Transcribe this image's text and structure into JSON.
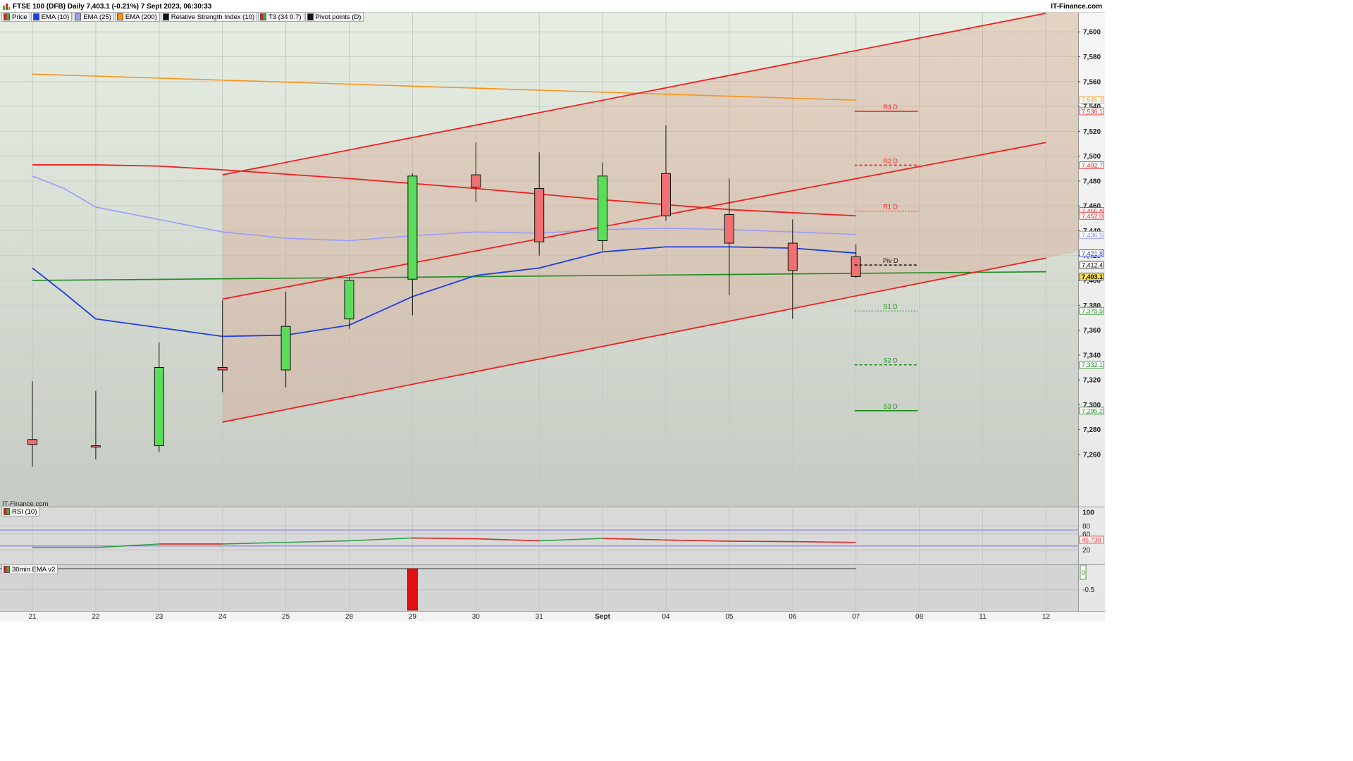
{
  "title_bar": {
    "title": "FTSE 100 (DFB) Daily 7,403.1 (-0.21%) 7 Sept 2023, 06:30:33",
    "brand": "IT-Finance.com"
  },
  "legend": [
    {
      "label": "Price",
      "color": "#3cb043"
    },
    {
      "label": "EMA (10)",
      "color": "#1f3fe0"
    },
    {
      "label": "EMA (25)",
      "color": "#9c9cf8"
    },
    {
      "label": "EMA (200)",
      "color": "#f7941d"
    },
    {
      "label": "Relative Strength Index (10)",
      "color": "#111111"
    },
    {
      "label": "T3 (34 0.7)",
      "color": "#e41a1c"
    },
    {
      "label": "Pivot points (D)",
      "color": "#111111"
    }
  ],
  "watermark": "IT-Finance.com",
  "colors": {
    "bull": "#5bdc5b",
    "bear": "#ef7070",
    "ema10": "#1f3fe0",
    "ema25": "#9c9cf8",
    "ema200": "#f7941d",
    "channel": "#ee2222",
    "t3": "#ee2222",
    "green_line": "#1f8a1f",
    "rsi_up": "#2a9d4a",
    "rsi_down": "#ee2222"
  },
  "chart_data": [
    {
      "type": "candlestick",
      "name": "price",
      "x_labels": [
        "21",
        "22",
        "23",
        "24",
        "25",
        "28",
        "29",
        "30",
        "31",
        "Sept",
        "04",
        "05",
        "06",
        "07",
        "08",
        "11",
        "12"
      ],
      "y_ticks": [
        7260,
        7280,
        7300,
        7320,
        7340,
        7360,
        7380,
        7400,
        7420,
        7440,
        7460,
        7480,
        7500,
        7520,
        7540,
        7560,
        7580,
        7600
      ],
      "y_tick_labels": [
        "7,260",
        "7,280",
        "7,300",
        "7,320",
        "7,340",
        "7,360",
        "7,380",
        "7,400",
        "7,420",
        "7,440",
        "7,460",
        "7,480",
        "7,500",
        "7,520",
        "7,540",
        "7,560",
        "7,580",
        "7,600"
      ],
      "ylim": [
        7218,
        7616
      ],
      "candles": [
        {
          "x": 0,
          "open": 7272,
          "high": 7319,
          "low": 7250,
          "close": 7268
        },
        {
          "x": 1,
          "open": 7267,
          "high": 7311,
          "low": 7256,
          "close": 7266
        },
        {
          "x": 2,
          "open": 7267,
          "high": 7350,
          "low": 7262,
          "close": 7330
        },
        {
          "x": 3,
          "open": 7330,
          "high": 7384,
          "low": 7310,
          "close": 7328
        },
        {
          "x": 4,
          "open": 7328,
          "high": 7391,
          "low": 7314,
          "close": 7363
        },
        {
          "x": 5,
          "open": 7369,
          "high": 7402,
          "low": 7361,
          "close": 7400
        },
        {
          "x": 6,
          "open": 7401,
          "high": 7486,
          "low": 7372,
          "close": 7484
        },
        {
          "x": 7,
          "open": 7485,
          "high": 7511,
          "low": 7463,
          "close": 7475
        },
        {
          "x": 8,
          "open": 7474,
          "high": 7503,
          "low": 7420,
          "close": 7431
        },
        {
          "x": 9,
          "open": 7432,
          "high": 7495,
          "low": 7424,
          "close": 7484
        },
        {
          "x": 10,
          "open": 7486,
          "high": 7525,
          "low": 7448,
          "close": 7452
        },
        {
          "x": 11,
          "open": 7453,
          "high": 7482,
          "low": 7388,
          "close": 7430
        },
        {
          "x": 12,
          "open": 7430,
          "high": 7449,
          "low": 7369,
          "close": 7408
        },
        {
          "x": 13,
          "open": 7419,
          "high": 7429,
          "low": 7402,
          "close": 7403.1
        }
      ],
      "ema10": [
        [
          0,
          7410
        ],
        [
          0.5,
          7390
        ],
        [
          1,
          7369
        ],
        [
          3,
          7355
        ],
        [
          4,
          7356
        ],
        [
          5,
          7364
        ],
        [
          6,
          7387
        ],
        [
          7,
          7404
        ],
        [
          8,
          7410
        ],
        [
          9,
          7423
        ],
        [
          10,
          7427
        ],
        [
          11,
          7427
        ],
        [
          12,
          7426
        ],
        [
          13,
          7422
        ]
      ],
      "ema25": [
        [
          0,
          7484
        ],
        [
          0.5,
          7474
        ],
        [
          1,
          7459
        ],
        [
          3,
          7439
        ],
        [
          4,
          7434
        ],
        [
          5,
          7432
        ],
        [
          6,
          7436
        ],
        [
          7,
          7439
        ],
        [
          8,
          7438
        ],
        [
          9,
          7441
        ],
        [
          10,
          7442
        ],
        [
          11,
          7441
        ],
        [
          12,
          7439
        ],
        [
          13,
          7437
        ]
      ],
      "ema200": [
        [
          0,
          7566
        ],
        [
          13,
          7545
        ]
      ],
      "t3": [
        [
          0,
          7493
        ],
        [
          1,
          7493
        ],
        [
          2,
          7492
        ],
        [
          3,
          7489
        ],
        [
          5,
          7482
        ],
        [
          7,
          7474
        ],
        [
          9,
          7465
        ],
        [
          11,
          7457
        ],
        [
          13,
          7452
        ]
      ],
      "green_line": [
        [
          0,
          7400
        ],
        [
          16,
          7407
        ]
      ],
      "channel": {
        "upper": [
          [
            3,
            7485
          ],
          [
            16,
            7615
          ]
        ],
        "middle": [
          [
            3,
            7385
          ],
          [
            16,
            7511
          ]
        ],
        "lower": [
          [
            3,
            7286
          ],
          [
            16,
            7418
          ]
        ],
        "fill_from_x": 3
      },
      "pivots": [
        {
          "label": "R3 D",
          "value": 7536.1,
          "style": "solid",
          "color": "#ee2222"
        },
        {
          "label": "R2 D",
          "value": 7492.7,
          "style": "dashed",
          "color": "#ee2222"
        },
        {
          "label": "R1 D",
          "value": 7455.8,
          "style": "dotted",
          "color": "#ee2222"
        },
        {
          "label": "Piv D",
          "value": 7412.4,
          "style": "dashed",
          "color": "#111111"
        },
        {
          "label": "S1 D",
          "value": 7375.5,
          "style": "dotted",
          "color": "#1f8a1f"
        },
        {
          "label": "S2 D",
          "value": 7332.1,
          "style": "dashed",
          "color": "#1f8a1f"
        },
        {
          "label": "S3 D",
          "value": 7295.2,
          "style": "solid",
          "color": "#1f8a1f"
        }
      ],
      "price_tags": [
        {
          "text": "7,545.3",
          "value": 7545.3,
          "color": "#f7941d",
          "text_color": "#f7941d"
        },
        {
          "text": "7,536.1",
          "value": 7536.1,
          "color": "#ee2222",
          "text_color": "#ee2222"
        },
        {
          "text": "7,492.7",
          "value": 7492.7,
          "color": "#ee2222",
          "text_color": "#ee2222"
        },
        {
          "text": "7,455.8",
          "value": 7455.8,
          "color": "#ee2222",
          "text_color": "#ee2222"
        },
        {
          "text": "7,452.0",
          "value": 7452.0,
          "color": "#ee2222",
          "text_color": "#ee2222"
        },
        {
          "text": "7,436.5",
          "value": 7436.5,
          "color": "#9c9cf8",
          "text_color": "#8080e8"
        },
        {
          "text": "7,421.8",
          "value": 7421.8,
          "color": "#1f3fe0",
          "text_color": "#1f3fe0"
        },
        {
          "text": "7,412.4",
          "value": 7412.4,
          "color": "#333333",
          "text_color": "#000000"
        },
        {
          "text": "7,403.1",
          "value": 7403.1,
          "color": "#333333",
          "text_color": "#000000",
          "bg": "#ffe44d",
          "bold": true
        },
        {
          "text": "7,375.5",
          "value": 7375.5,
          "color": "#1f8a1f",
          "text_color": "#1f8a1f"
        },
        {
          "text": "7,332.1",
          "value": 7332.1,
          "color": "#1f8a1f",
          "text_color": "#1f8a1f"
        },
        {
          "text": "7,295.2",
          "value": 7295.2,
          "color": "#1f8a1f",
          "text_color": "#1f8a1f"
        }
      ]
    },
    {
      "type": "line",
      "name": "rsi",
      "label": "RSI (10)",
      "ylim": [
        0,
        100
      ],
      "y_ticks": [
        100,
        80,
        60,
        20
      ],
      "y_tick_labels": [
        "100",
        "80",
        "60",
        "20"
      ],
      "levels": [
        70,
        30
      ],
      "current_tag": "45.730",
      "current_value": 45.73,
      "values": [
        [
          0,
          26
        ],
        [
          1,
          26
        ],
        [
          2,
          35
        ],
        [
          3,
          35
        ],
        [
          4,
          39
        ],
        [
          5,
          43
        ],
        [
          6,
          50
        ],
        [
          7,
          48
        ],
        [
          8,
          43
        ],
        [
          9,
          49
        ],
        [
          10,
          45
        ],
        [
          11,
          42
        ],
        [
          12,
          41
        ],
        [
          13,
          39
        ]
      ],
      "down_segments": [
        [
          2,
          3
        ],
        [
          6,
          8
        ],
        [
          9,
          13
        ]
      ]
    },
    {
      "type": "bar",
      "name": "ema_30min",
      "label": "30min EMA v2",
      "ylim": [
        -1,
        0
      ],
      "y_ticks": [
        -0.5
      ],
      "y_tick_labels": [
        "-0.5"
      ],
      "current_tag": "0",
      "bars": [
        {
          "x": 6,
          "value": -1
        }
      ]
    }
  ]
}
